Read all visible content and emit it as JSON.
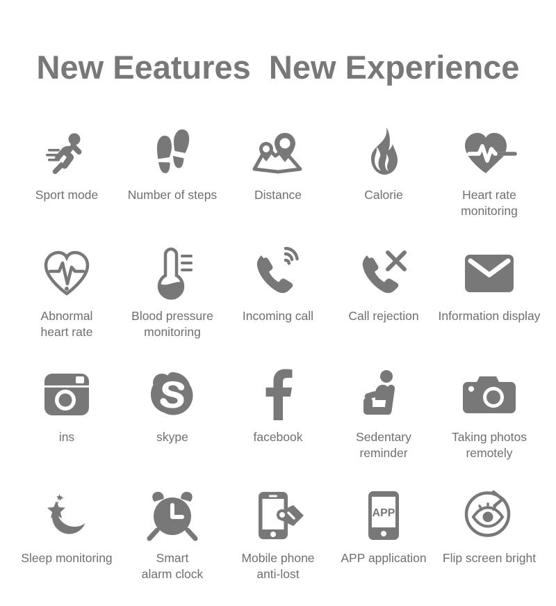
{
  "page": {
    "background_color": "#ffffff",
    "icon_color": "#787878",
    "text_color": "#6f6f6f"
  },
  "headline": {
    "text": "New Eeatures  New Experience"
  },
  "features": {
    "rows": [
      [
        {
          "icon": "running-person-icon",
          "label": "Sport mode"
        },
        {
          "icon": "footsteps-icon",
          "label": "Number of steps"
        },
        {
          "icon": "map-pins-icon",
          "label": "Distance"
        },
        {
          "icon": "flame-icon",
          "label": "Calorie"
        },
        {
          "icon": "heart-pulse-icon",
          "label": "Heart rate\nmonitoring"
        }
      ],
      [
        {
          "icon": "heart-outline-ecg-icon",
          "label": "Abnormal\nheart rate"
        },
        {
          "icon": "thermometer-icon",
          "label": "Blood pressure\nmonitoring"
        },
        {
          "icon": "phone-ringing-icon",
          "label": "Incoming call"
        },
        {
          "icon": "phone-reject-icon",
          "label": "Call rejection"
        },
        {
          "icon": "envelope-icon",
          "label": "Information display"
        }
      ],
      [
        {
          "icon": "instagram-camera-icon",
          "label": "ins"
        },
        {
          "icon": "skype-icon",
          "label": "skype"
        },
        {
          "icon": "facebook-icon",
          "label": "facebook"
        },
        {
          "icon": "seated-person-icon",
          "label": "Sedentary\nreminder"
        },
        {
          "icon": "camera-icon",
          "label": "Taking photos\nremotely"
        }
      ],
      [
        {
          "icon": "moon-stars-icon",
          "label": "Sleep monitoring"
        },
        {
          "icon": "alarm-clock-icon",
          "label": "Smart\nalarm clock"
        },
        {
          "icon": "phone-tag-icon",
          "label": "Mobile phone\nanti-lost"
        },
        {
          "icon": "phone-app-icon",
          "label": "APP application"
        },
        {
          "icon": "eye-rotate-icon",
          "label": "Flip screen bright"
        }
      ]
    ]
  }
}
